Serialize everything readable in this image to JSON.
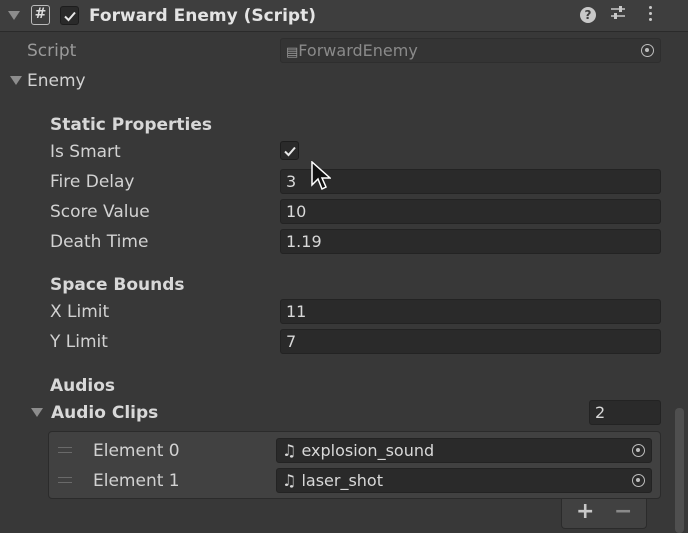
{
  "component": {
    "title": "Forward Enemy (Script)",
    "script_label": "Script",
    "script_value": "ForwardEnemy"
  },
  "enemy": {
    "foldout_label": "Enemy",
    "static_properties": {
      "header": "Static Properties",
      "is_smart_label": "Is Smart",
      "is_smart_value": true,
      "fire_delay_label": "Fire Delay",
      "fire_delay_value": "3",
      "score_value_label": "Score Value",
      "score_value_value": "10",
      "death_time_label": "Death Time",
      "death_time_value": "1.19"
    },
    "space_bounds": {
      "header": "Space Bounds",
      "x_limit_label": "X Limit",
      "x_limit_value": "11",
      "y_limit_label": "Y Limit",
      "y_limit_value": "7"
    },
    "audios": {
      "header": "Audios",
      "audio_clips_label": "Audio Clips",
      "audio_clips_count": "2",
      "elements": [
        {
          "label": "Element 0",
          "value": "explosion_sound"
        },
        {
          "label": "Element 1",
          "value": "laser_shot"
        }
      ],
      "add_label": "+",
      "remove_label": "−"
    }
  },
  "icons": {
    "script_hash": "#",
    "help": "?",
    "settings": "⇵",
    "more": "⋮",
    "audio_note": "♫",
    "script_file": "▤"
  },
  "colors": {
    "background": "#383838",
    "header": "#3e3e3e",
    "field": "#2a2a2a",
    "text": "#d2d2d2"
  }
}
